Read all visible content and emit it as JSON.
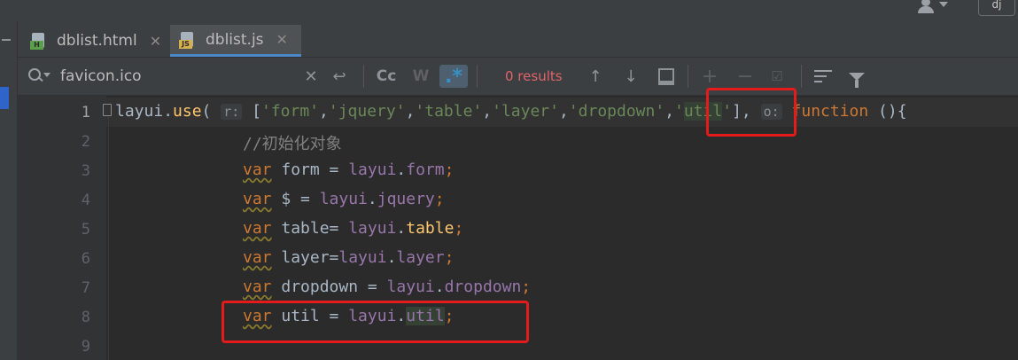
{
  "window": {
    "project_badge": "dj"
  },
  "tabs": [
    {
      "icon": "html-file-icon",
      "icon_label": "H",
      "label": "dblist.html",
      "close": "✕"
    },
    {
      "icon": "js-file-icon",
      "icon_label": "JS",
      "label": "dblist.js",
      "close": "✕"
    }
  ],
  "search": {
    "value": "favicon.ico",
    "match_case_label": "Cc",
    "words_label": "W",
    "regex_label": ".*",
    "results": "0 results"
  },
  "line_numbers": [
    "1",
    "2",
    "3",
    "4",
    "5",
    "6",
    "7",
    "8",
    "9"
  ],
  "code": {
    "l1": {
      "obj": "layui",
      "dot": ".",
      "method": "use",
      "open": "(",
      "hint_modules": "r:",
      "arr_open": "[",
      "s1": "'form'",
      "s2": "'jquery'",
      "s3": "'table'",
      "s4": "'layer'",
      "s5": "'dropdown'",
      "c": ",",
      "s6_q1": "'",
      "s6_word": "util",
      "s6_q2": "'",
      "arr_close": "],",
      "hint_fn": "o:",
      "kw_function": "function",
      "tail": " (){"
    },
    "l2": {
      "comment": "//初始化对象"
    },
    "l3": {
      "kw": "var",
      "name": " form = ",
      "obj": "layui",
      "dot": ".",
      "prop": "form",
      "semi": ";"
    },
    "l4": {
      "kw": "var",
      "name": " $ = ",
      "obj": "layui",
      "dot": ".",
      "prop": "jquery",
      "semi": ";"
    },
    "l5": {
      "kw": "var",
      "name": " table= ",
      "obj": "layui",
      "dot": ".",
      "prop": "table",
      "semi": ";"
    },
    "l6": {
      "kw": "var",
      "name": " layer=",
      "obj": "layui",
      "dot": ".",
      "prop": "layer",
      "semi": ";"
    },
    "l7": {
      "kw": "var",
      "name": " dropdown = ",
      "obj": "layui",
      "dot": ".",
      "prop": "dropdown",
      "semi": ";"
    },
    "l8": {
      "kw": "var",
      "name": " util = ",
      "obj": "layui",
      "dot": ".",
      "prop": "util",
      "semi": ";"
    }
  }
}
